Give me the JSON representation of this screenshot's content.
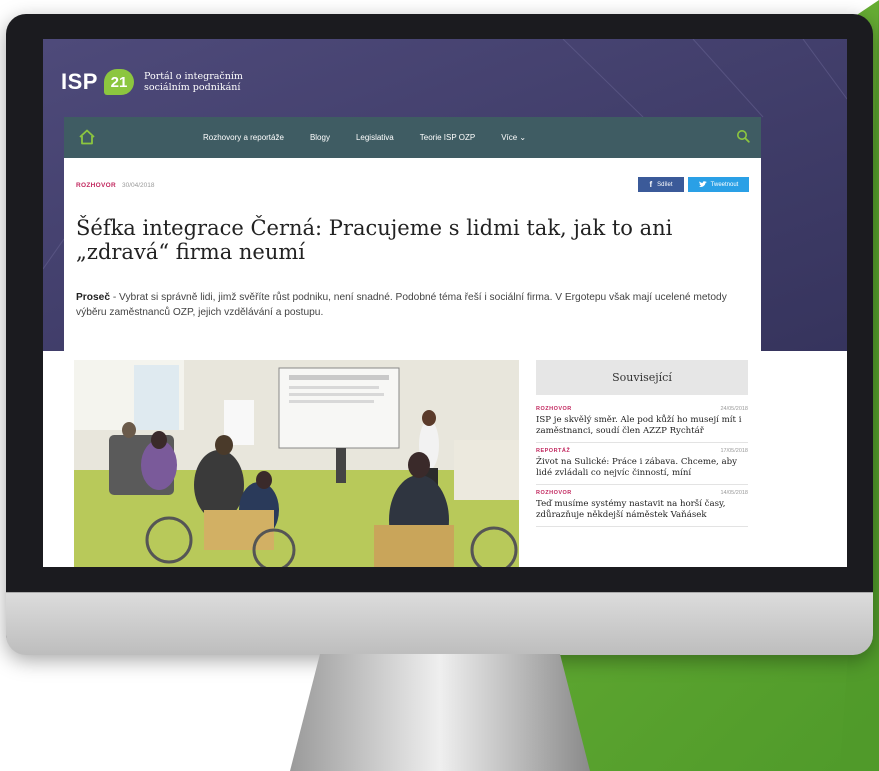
{
  "site": {
    "logo_text": "ISP",
    "logo_number": "21",
    "tagline": "Portál o integračním sociálním podnikání"
  },
  "nav": {
    "items": [
      {
        "label": "Rozhovory a reportáže"
      },
      {
        "label": "Blogy"
      },
      {
        "label": "Legislativa"
      },
      {
        "label": "Teorie ISP OZP"
      },
      {
        "label": "Více  ⌄"
      }
    ]
  },
  "article": {
    "category": "ROZHOVOR",
    "date": "30/04/2018",
    "share_facebook": "Sdílet",
    "share_twitter": "Tweetnout",
    "title": "Šéfka integrace Černá: Pracujeme s lidmi tak, jak to ani „zdravá“ firma neumí",
    "lead_place": "Proseč",
    "lead_text": " - Vybrat si správně lidi, jimž svěříte růst podniku, není snadné. Podobné téma řeší i sociální firma. V Ergotepu však mají ucelené metody výběru zaměstnanců OZP, jejich vzdělávání a postupu."
  },
  "related": {
    "heading": "Související",
    "items": [
      {
        "category": "ROZHOVOR",
        "date": "24/05/2018",
        "title": "ISP je skvělý směr. Ale pod kůží ho musejí mít i zaměstnanci, soudí člen AZZP Rychtář"
      },
      {
        "category": "REPORTÁŽ",
        "date": "17/05/2018",
        "title": "Život na Sulické: Práce i zábava. Chceme, aby lidé zvládali co nejvíc činností, míní"
      },
      {
        "category": "ROZHOVOR",
        "date": "14/05/2018",
        "title": "Teď musíme systémy nastavit na horší časy, zdůrazňuje někdejší náměstek Vaňásek"
      }
    ]
  },
  "colors": {
    "hero": "#4e4a7a",
    "nav": "#3f5c63",
    "accent_green": "#8cc63f",
    "category_pink": "#c2285f",
    "facebook": "#3b5a99",
    "twitter": "#2aa0e6"
  }
}
